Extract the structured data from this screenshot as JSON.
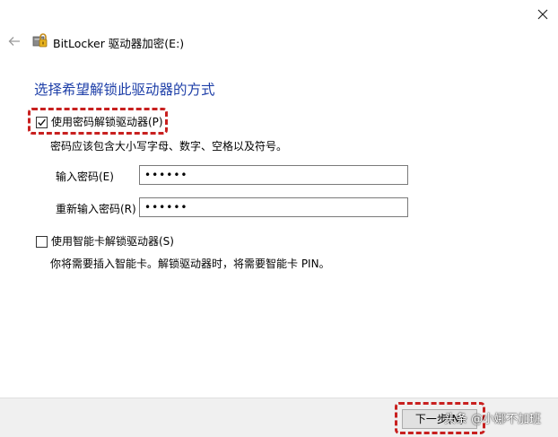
{
  "window": {
    "title": "BitLocker 驱动器加密(E:)"
  },
  "main": {
    "heading": "选择希望解锁此驱动器的方式",
    "password_option": {
      "label": "使用密码解锁驱动器(P)",
      "checked": true,
      "hint": "密码应该包含大小写字母、数字、空格以及符号。",
      "password_label": "输入密码(E)",
      "password_value": "••••••",
      "reenter_label": "重新输入密码(R)",
      "reenter_value": "••••••"
    },
    "smartcard_option": {
      "label": "使用智能卡解锁驱动器(S)",
      "checked": false,
      "hint": "你将需要插入智能卡。解锁驱动器时，将需要智能卡 PIN。"
    }
  },
  "footer": {
    "next_label": "下一步(N)"
  },
  "watermark": {
    "text": "头条 @小娜不加班"
  },
  "colors": {
    "heading": "#1e3fa8",
    "highlight": "#c8201f",
    "footer_bg": "#f0f0f0"
  },
  "icons": {
    "close": "close-icon",
    "back": "back-arrow-icon",
    "app": "bitlocker-icon",
    "check": "checkmark-icon"
  }
}
